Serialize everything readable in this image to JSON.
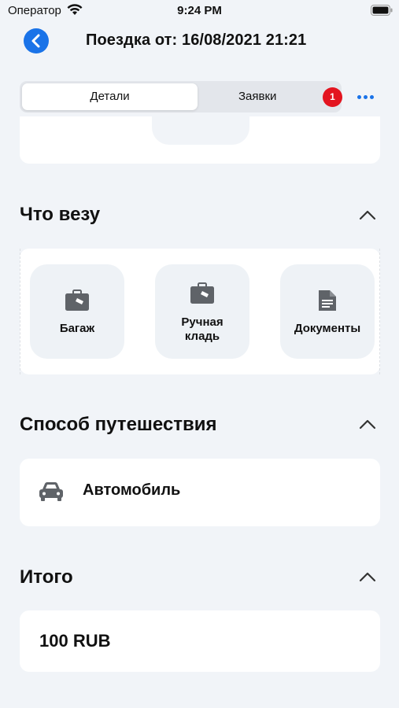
{
  "status_bar": {
    "carrier": "Оператор",
    "time": "9:24 PM"
  },
  "header": {
    "title": "Поездка от: 16/08/2021 21:21"
  },
  "tabs": {
    "details": "Детали",
    "requests": "Заявки",
    "requests_badge": "1"
  },
  "sections": {
    "cargo": {
      "title": "Что везу",
      "items": [
        {
          "label": "Багаж",
          "icon": "suitcase-icon"
        },
        {
          "label": "Ручная\nкладь",
          "icon": "hand-luggage-icon"
        },
        {
          "label": "Документы",
          "icon": "document-icon"
        }
      ]
    },
    "travel": {
      "title": "Способ путешествия",
      "method": "Автомобиль",
      "icon": "car-icon"
    },
    "total": {
      "title": "Итого",
      "value": "100 RUB"
    }
  },
  "colors": {
    "accent": "#1a73e8",
    "badge": "#e3141f",
    "background": "#f1f4f8"
  }
}
